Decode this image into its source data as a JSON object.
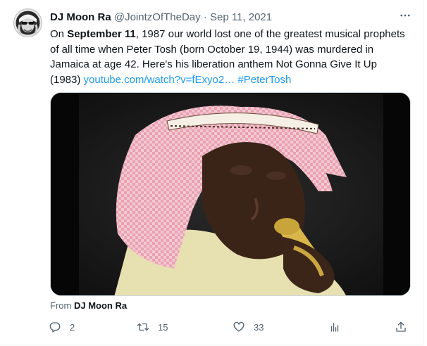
{
  "tweet": {
    "author_name": "DJ Moon Ra",
    "author_handle": "@JointzOfTheDay",
    "separator": "·",
    "date": "Sep 11, 2021",
    "text": {
      "part1": "On ",
      "bold1": "September 11",
      "part2": ", 1987 our world lost one of the greatest musical prophets of all time when Peter Tosh (born October 19, 1944) was murdered in Jamaica at age 42. Here's his liberation anthem Not Gonna Give It Up (1983) ",
      "link": "youtube.com/watch?v=fExyo2…",
      "space": " ",
      "hashtag": "#PeterTosh"
    },
    "from_label": "From",
    "from_name": "DJ Moon Ra"
  },
  "actions": {
    "reply_count": "2",
    "retweet_count": "15",
    "like_count": "33"
  },
  "icons": [
    "more-icon",
    "reply-icon",
    "retweet-icon",
    "like-icon",
    "analytics-icon",
    "share-icon"
  ],
  "colors": {
    "link": "#1d9bf0",
    "secondary_text": "#536471",
    "primary_text": "#0f1419"
  }
}
